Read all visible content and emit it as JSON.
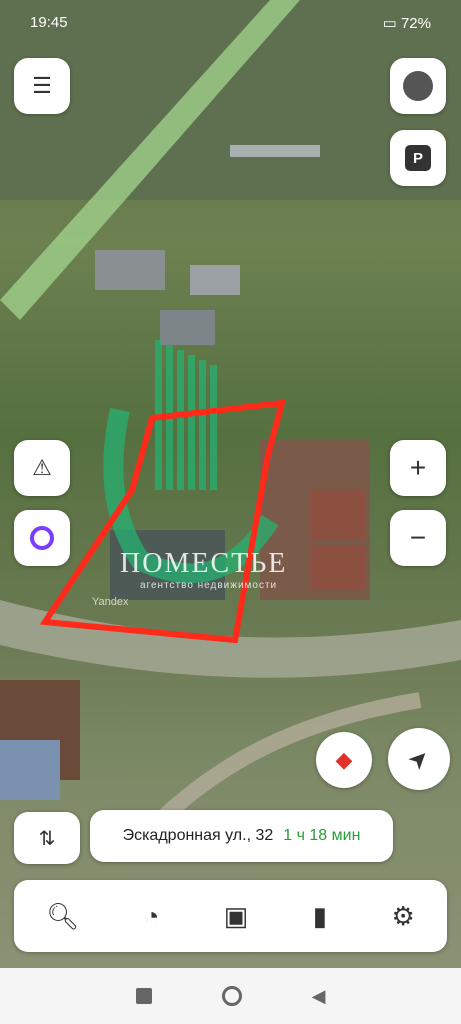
{
  "status": {
    "time": "19:45",
    "battery": "72"
  },
  "map": {
    "watermark": "ПОМЕСТЬЕ",
    "watermark_sub": "агентство недвижимости",
    "provider": "Yandex"
  },
  "controls": {
    "plus": "+",
    "minus": "−",
    "parking": "P"
  },
  "route": {
    "address": "Эскадронная ул., 32",
    "eta": "1 ч 18 мин"
  },
  "colors": {
    "plot_outline": "#ff2a1a",
    "eta": "#2a9d3a",
    "alice": "#7b3cff"
  }
}
